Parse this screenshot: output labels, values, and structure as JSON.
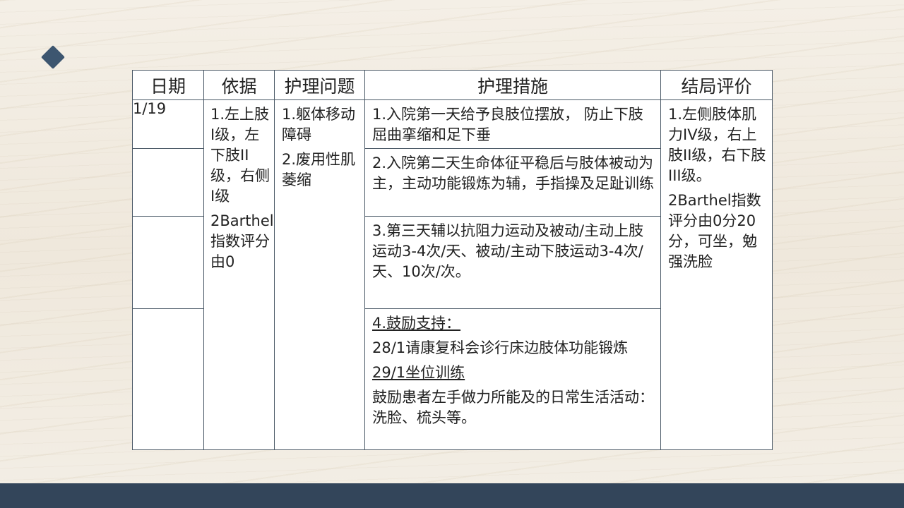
{
  "headers": {
    "date": "日期",
    "basis": "依据",
    "problem": "护理问题",
    "measures": "护理措施",
    "evaluation": "结局评价"
  },
  "date": "1/19",
  "basis": [
    "1.左上肢I级，左下肢II级，右侧I级",
    "2Barthel指数评分由0"
  ],
  "problems": [
    "1.躯体移动障碍",
    "2.废用性肌萎缩"
  ],
  "measures": {
    "m1": "1.入院第一天给予良肢位摆放， 防止下肢屈曲挛缩和足下垂",
    "m2": "2.入院第二天生命体征平稳后与肢体被动为主，主动功能锻炼为辅，手指操及足趾训练",
    "m3": "3.第三天辅以抗阻力运动及被动/主动上肢运动3-4次/天、被动/主动下肢运动3-4次/天、10次/次。",
    "m4_title": "4.鼓励支持：",
    "m4_line1": "28/1请康复科会诊行床边肢体功能锻炼",
    "m4_line2": "29/1坐位训练",
    "m4_line3": "鼓励患者左手做力所能及的日常生活活动：洗脸、梳头等。"
  },
  "evaluation": [
    "1.左侧肢体肌力IV级，右上肢II级，右下肢III级。",
    "2Barthel指数评分由0分20分，可坐，勉强洗脸"
  ],
  "colors": {
    "accent": "#3d5670",
    "footer": "#33455a",
    "border": "#4a5866"
  }
}
